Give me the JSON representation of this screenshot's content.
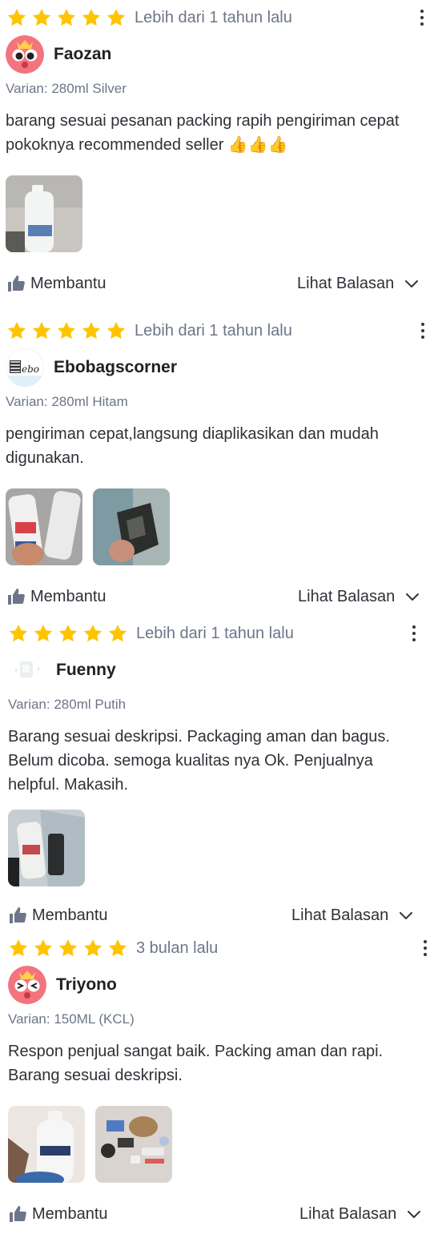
{
  "reviews": [
    {
      "rating": 5,
      "time": "Lebih dari 1 tahun lalu",
      "user": "Faozan",
      "avatar_icon": "pink-mascot-avatar-icon",
      "variant": "Varian: 280ml Silver",
      "text": "barang sesuai pesanan packing rapih pengiriman cepat pokoknya recommended seller 👍👍👍",
      "photo_count": 1,
      "helpful_label": "Membantu",
      "replies_label": "Lihat Balasan"
    },
    {
      "rating": 5,
      "time": "Lebih dari 1 tahun lalu",
      "user": "Ebobagscorner",
      "avatar_icon": "zebra-logo-avatar-icon",
      "variant": "Varian: 280ml Hitam",
      "text": "pengiriman cepat,langsung diaplikasikan dan mudah digunakan.",
      "photo_count": 2,
      "helpful_label": "Membantu",
      "replies_label": "Lihat Balasan"
    },
    {
      "rating": 5,
      "time": "Lebih dari 1 tahun lalu",
      "user": "Fuenny",
      "avatar_icon": "faint-photo-avatar-icon",
      "variant": "Varian: 280ml Putih",
      "text": "Barang sesuai deskripsi. Packaging aman dan bagus. Belum dicoba. semoga kualitas nya Ok. Penjualnya helpful. Makasih.",
      "photo_count": 1,
      "helpful_label": "Membantu",
      "replies_label": "Lihat Balasan"
    },
    {
      "rating": 5,
      "time": "3 bulan lalu",
      "user": "Triyono",
      "avatar_icon": "pink-mascot-squint-avatar-icon",
      "variant": "Varian: 150ML (KCL)",
      "text": "Respon penjual sangat baik. Packing aman dan rapi. Barang sesuai deskripsi.",
      "photo_count": 2,
      "helpful_label": "Membantu",
      "replies_label": "Lihat Balasan"
    }
  ],
  "colors": {
    "star": "#ffc400",
    "muted_text": "#6d7588",
    "body_text": "#2e3137",
    "icon": "#6d7588"
  }
}
